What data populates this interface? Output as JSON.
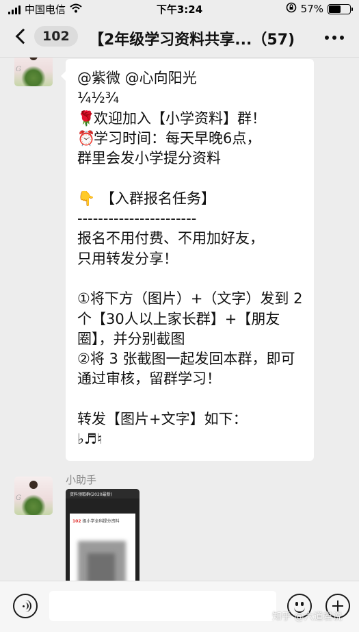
{
  "status_bar": {
    "carrier": "中国电信",
    "time": "下午3:24",
    "battery": "57%",
    "battery_level": 0.57
  },
  "nav": {
    "unread_count": "102",
    "title": "【2年级学习资料共享...（57)"
  },
  "message": {
    "lines": [
      "@紫微 @心向阳光",
      "¼½¾",
      "欢迎加入【小学资料】群！",
      "学习时间：每天早晚6点，",
      "群里会发小学提分资料",
      "",
      "【入群报名任务】",
      "-----------------------",
      "报名不用付费、不用加好友，",
      "只用转发分享！",
      "",
      "①将下方（图片）+（文字）发到 2个【30人以上家长群】+【朋友圈】，并分别截图",
      "②将 3 张截图一起发回本群，即可通过审核，留群学习！",
      "",
      "转发【图片+文字】如下：",
      "♭♬♮"
    ],
    "emojis": {
      "rose": "🌹",
      "alarm": "⏰",
      "point_down": "👇"
    }
  },
  "second_message": {
    "sender": "小助手",
    "image_top_text": "资料领取群(2020最新)",
    "image_card_number": "102",
    "image_card_title": "级小学全科提分资料"
  },
  "watermark": "知乎 @六道君说"
}
